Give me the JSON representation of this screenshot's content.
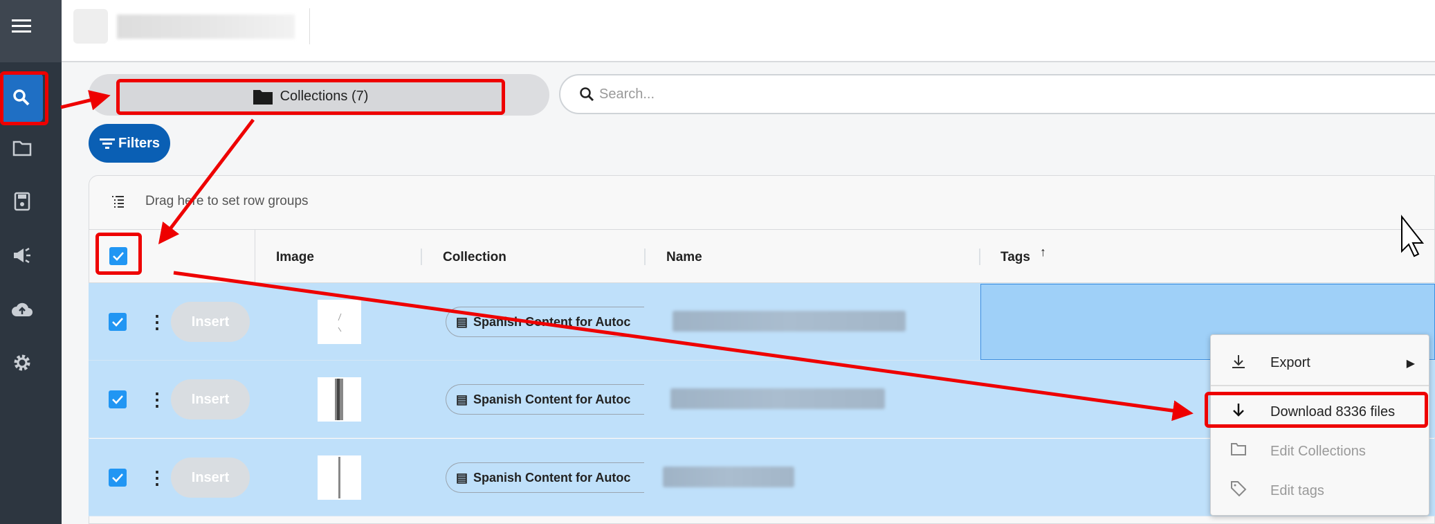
{
  "sidebar": {
    "items": [
      "menu",
      "search",
      "folder",
      "save",
      "announcements",
      "upload",
      "settings"
    ]
  },
  "collections_button": {
    "label": "Collections (7)"
  },
  "search": {
    "placeholder": "Search..."
  },
  "filters_button": {
    "label": "Filters"
  },
  "grid": {
    "row_group_hint": "Drag here to set row groups",
    "columns": [
      "Image",
      "Collection",
      "Name",
      "Tags"
    ],
    "rows": [
      {
        "insert": "Insert",
        "collection": "Spanish Content for Autoc"
      },
      {
        "insert": "Insert",
        "collection": "Spanish Content for Autoc"
      },
      {
        "insert": "Insert",
        "collection": "Spanish Content for Autoc"
      }
    ]
  },
  "context_menu": {
    "items": [
      {
        "label": "Export",
        "icon": "export-icon"
      },
      {
        "label": "Download 8336 files",
        "icon": "arrow-down-icon"
      },
      {
        "label": "Edit Collections",
        "icon": "folder-icon"
      },
      {
        "label": "Edit tags",
        "icon": "tag-icon"
      }
    ]
  },
  "colors": {
    "accent": "#1565c0",
    "selected_row": "#bfe0fa",
    "annotation": "#ee0000"
  }
}
